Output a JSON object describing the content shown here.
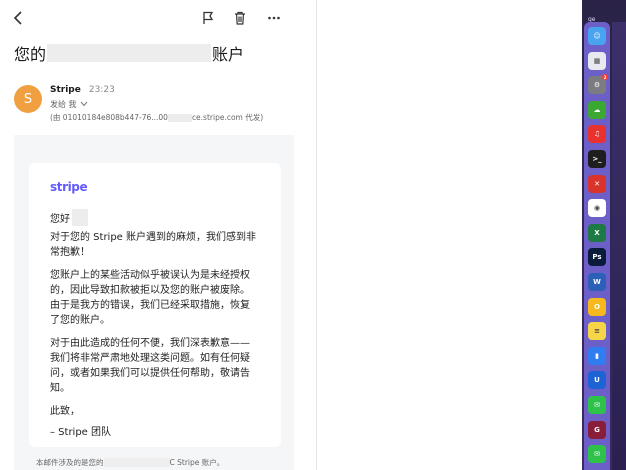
{
  "toolbar": {
    "back_icon": "chevron-left-icon",
    "flag_icon": "flag-icon",
    "delete_icon": "trash-icon",
    "more_icon": "more-horizontal-icon"
  },
  "email": {
    "subject_prefix": "您的",
    "subject_suffix": "账户",
    "sender_initial": "S",
    "sender_name": "Stripe",
    "sent_time": "23:23",
    "recipient": "发给 我",
    "via_prefix": "(由 01010184e808b447-76...00",
    "via_suffix": "ce.stripe.com 代发)",
    "logo": "stripe",
    "greeting": "您好",
    "paragraphs": [
      "对于您的 Stripe 账户遇到的麻烦，我们感到非常抱歉！",
      "您账户上的某些活动似乎被误认为是未经授权的，因此导致扣款被拒以及您的账户被废除。由于是我方的错误，我们已经采取措施，恢复了您的账户。",
      "对于由此造成的任何不便，我们深表歉意——我们将非常严肃地处理这类问题。如有任何疑问，或者如果我们可以提供任何帮助，敬请告知。",
      "此致，",
      "– Stripe 团队"
    ],
    "footer_prefix": "本邮件涉及的是您的",
    "footer_suffix": "C Stripe 账户。"
  },
  "dock": {
    "label": "ge",
    "items": [
      {
        "name": "finder-icon",
        "color": "#4aa3f0",
        "glyph": "☺"
      },
      {
        "name": "launchpad-icon",
        "color": "#e8e8f0",
        "glyph": "▦"
      },
      {
        "name": "system-settings-icon",
        "color": "#7b7b80",
        "glyph": "⚙",
        "badge": "2"
      },
      {
        "name": "green-cloud-app-icon",
        "color": "#3aa832",
        "glyph": "☁"
      },
      {
        "name": "red-audio-app-icon",
        "color": "#e8322f",
        "glyph": "♫"
      },
      {
        "name": "terminal-icon",
        "color": "#1e1e1e",
        "glyph": ">_"
      },
      {
        "name": "red-remote-app-icon",
        "color": "#d9342b",
        "glyph": "✕"
      },
      {
        "name": "chrome-icon",
        "color": "#ffffff",
        "glyph": "◉"
      },
      {
        "name": "excel-icon",
        "color": "#1d7a45",
        "glyph": "X"
      },
      {
        "name": "photoshop-icon",
        "color": "#0b1b3a",
        "glyph": "Ps"
      },
      {
        "name": "word-icon",
        "color": "#2b5fb8",
        "glyph": "W"
      },
      {
        "name": "yellow-app-icon",
        "color": "#f6b81e",
        "glyph": "O"
      },
      {
        "name": "notes-icon",
        "color": "#f7d548",
        "glyph": "≡"
      },
      {
        "name": "blue-app-icon",
        "color": "#2f7df0",
        "glyph": "▮"
      },
      {
        "name": "u-app-icon",
        "color": "#1e63d6",
        "glyph": "U"
      },
      {
        "name": "wechat-icon",
        "color": "#2ec24b",
        "glyph": "✉"
      },
      {
        "name": "pdf-app-icon",
        "color": "#8a1d3a",
        "glyph": "G"
      },
      {
        "name": "wechat-work-icon",
        "color": "#2ec24b",
        "glyph": "✉"
      }
    ]
  }
}
